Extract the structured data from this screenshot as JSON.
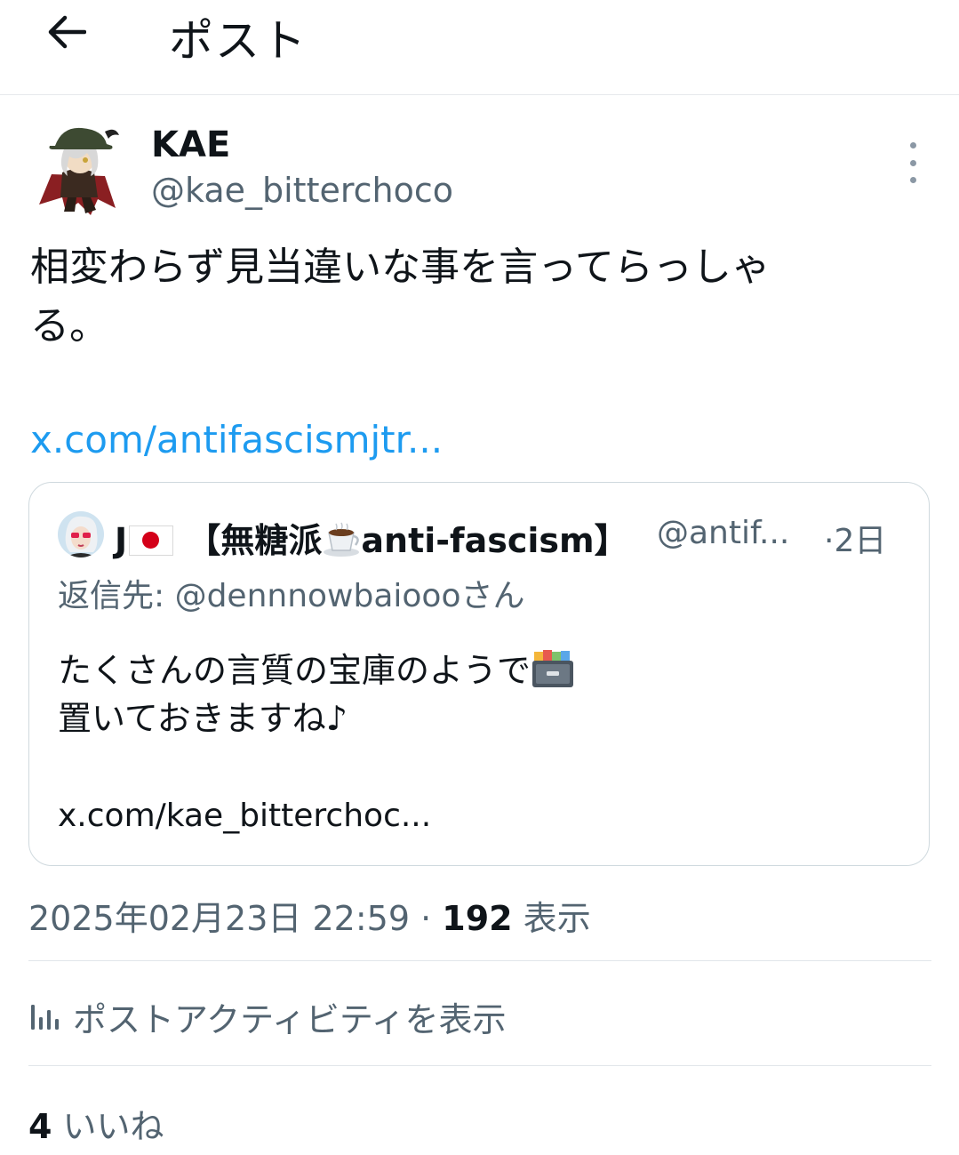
{
  "header": {
    "title": "ポスト",
    "back_icon": "arrow-left-icon"
  },
  "post": {
    "display_name": "KAE",
    "handle": "@kae_bitterchoco",
    "text": "相変わらず見当違いな事を言ってらっしゃ\nる。",
    "link": "x.com/antifascismjtr..."
  },
  "quote": {
    "name_prefix": "J",
    "name_mid": "【無糖派",
    "name_suffix": "anti-fascism】",
    "handle": "@antif...",
    "time": "·2日",
    "reply_label": "返信先: @dennnowbaioooさん",
    "text_line1": "たくさんの言質の宝庫のようで",
    "text_line2": "置いておきますね♪",
    "link": "x.com/kae_bitterchoc..."
  },
  "meta": {
    "datetime": "2025年02月23日 22:59",
    "separator": "·",
    "views_count": "192",
    "views_label": "表示"
  },
  "activity": {
    "label": "ポストアクティビティを表示"
  },
  "likes": {
    "count": "4",
    "label": "いいね"
  },
  "colors": {
    "link": "#1d9bf0",
    "secondary_text": "#536471",
    "border": "#cfd9de"
  }
}
